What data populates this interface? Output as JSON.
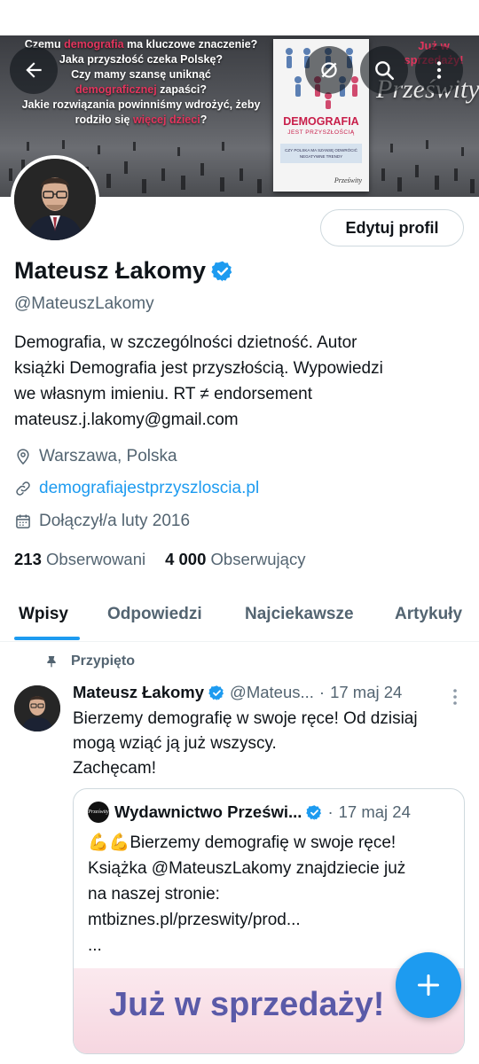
{
  "banner": {
    "lines": [
      [
        "Czemu ",
        "demografia",
        " ma kluczowe znaczenie?"
      ],
      [
        "Jaka przyszłość czeka Polskę?"
      ],
      [
        "Czy mamy szansę uniknąć"
      ],
      [
        "demograficznej",
        " zapaści?"
      ],
      [
        "Jakie rozwiązania powinniśmy wdrożyć, żeby"
      ],
      [
        "rodziło się ",
        "więcej dzieci",
        "?"
      ]
    ],
    "book_title": "DEMOGRAFIA",
    "book_subtitle": "JEST PRZYSZŁOŚCIĄ",
    "book_band": "CZY POLSKA MA SZANSĘ ODWRÓCIĆ NEGATYWNE TRENDY",
    "book_publisher": "Prześwity",
    "brand": "Prześwity",
    "already_line1": "Już w",
    "already_line2": "sprzedaży!"
  },
  "nav": {
    "back_icon": "back-arrow-icon",
    "grok_icon": "grok-icon",
    "search_icon": "search-icon",
    "more_icon": "more-vertical-icon"
  },
  "profile": {
    "edit_label": "Edytuj profil",
    "name": "Mateusz Łakomy",
    "handle": "@MateuszLakomy",
    "bio_lines": [
      "Demografia, w szczególności dzietność. Autor",
      "książki Demografia jest przyszłością. Wypowiedzi",
      "we własnym imieniu. RT ≠ endorsement",
      "mateusz.j.lakomy@gmail.com"
    ],
    "location": "Warszawa, Polska",
    "website": "demografiajestprzyszloscia.pl",
    "joined": "Dołączył/a luty 2016",
    "following_count": "213",
    "following_label": "Obserwowani",
    "followers_count": "4 000",
    "followers_label": "Obserwujący"
  },
  "tabs": [
    "Wpisy",
    "Odpowiedzi",
    "Najciekawsze",
    "Artykuły"
  ],
  "pinned_tweet": {
    "pinned_label": "Przypięto",
    "author": "Mateusz Łakomy",
    "handle": "@Mateus...",
    "separator": "·",
    "date": "17 maj 24",
    "text_lines": [
      "Bierzemy demografię w swoje ręce! Od dzisiaj",
      "mogą wziąć ją już wszyscy.",
      "Zachęcam!"
    ],
    "quote": {
      "logo_text": "Prześwity",
      "author": "Wydawnictwo Prześwi...",
      "separator": "·",
      "date": "17 maj 24",
      "text_lines": [
        "💪💪Bierzemy demografię w swoje ręce!",
        "Książka @MateuszLakomy znajdziecie już",
        "na naszej stronie:",
        "mtbiznes.pl/przeswity/prod...",
        "..."
      ],
      "image_text": "Już w sprzedaży!"
    }
  },
  "fab_icon": "plus-icon",
  "colors": {
    "accent": "#1d9bf0",
    "text": "#0f1419",
    "secondary": "#536471",
    "banner_red": "#e2355d"
  }
}
